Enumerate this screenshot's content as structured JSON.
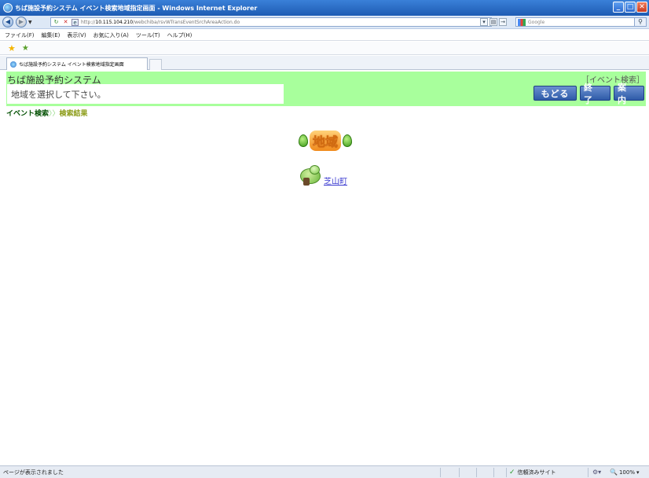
{
  "window": {
    "title": "ちば施設予約システム イベント検索地域指定画面 - Windows Internet Explorer"
  },
  "address": {
    "url_prefix": "http://",
    "url_host": "10.115.104.210",
    "url_path": "/webchiba/rsvWTransEventSrchAreaAction.do",
    "search_placeholder": "Google"
  },
  "menu": [
    "ファイル(F)",
    "編集(E)",
    "表示(V)",
    "お気に入り(A)",
    "ツール(T)",
    "ヘルプ(H)"
  ],
  "tab": {
    "label": "ちば施設予約システム イベント検索地域指定画面"
  },
  "page": {
    "system_title": "ちば施設予約システム",
    "event_label": "［イベント検索］",
    "message": "地域を選択して下さい。",
    "buttons": {
      "back": "もどる",
      "end": "終了",
      "info": "案内"
    },
    "breadcrumb": {
      "current": "イベント検索",
      "separator": "〉〉",
      "next": "検索結果"
    },
    "region_heading": "地域",
    "town_link": "芝山町"
  },
  "status": {
    "text": "ページが表示されました",
    "zone": "信頼済みサイト",
    "zoom": "100%"
  },
  "colors": {
    "header_bg": "#a8ff9c",
    "button_bg": "#2e5ba8",
    "link": "#3a3ad0"
  }
}
